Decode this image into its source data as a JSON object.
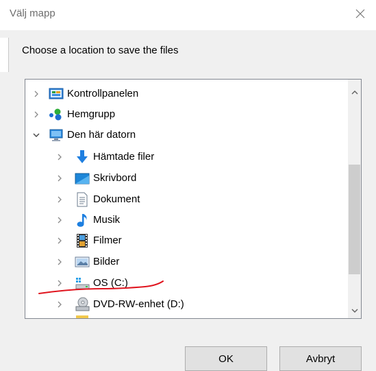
{
  "dialog": {
    "title": "Välj mapp",
    "prompt": "Choose a location to save the files"
  },
  "tree": {
    "items": [
      {
        "label": "Kontrollpanelen",
        "icon": "control-panel-icon",
        "expander": "collapsed"
      },
      {
        "label": "Hemgrupp",
        "icon": "homegroup-icon",
        "expander": "collapsed"
      },
      {
        "label": "Den här datorn",
        "icon": "computer-icon",
        "expander": "expanded"
      },
      {
        "label": "Hämtade filer",
        "icon": "downloads-icon",
        "expander": "collapsed"
      },
      {
        "label": "Skrivbord",
        "icon": "desktop-icon",
        "expander": "collapsed"
      },
      {
        "label": "Dokument",
        "icon": "documents-icon",
        "expander": "collapsed"
      },
      {
        "label": "Musik",
        "icon": "music-icon",
        "expander": "collapsed"
      },
      {
        "label": "Filmer",
        "icon": "videos-icon",
        "expander": "collapsed"
      },
      {
        "label": "Bilder",
        "icon": "pictures-icon",
        "expander": "collapsed"
      },
      {
        "label": "OS (C:)",
        "icon": "drive-icon",
        "expander": "collapsed"
      },
      {
        "label": "DVD-RW-enhet (D:)",
        "icon": "dvd-drive-icon",
        "expander": "collapsed"
      }
    ]
  },
  "buttons": {
    "ok": "OK",
    "cancel": "Avbryt"
  },
  "colors": {
    "annotation": "#e0141e",
    "accent": "#1e7fd8"
  }
}
